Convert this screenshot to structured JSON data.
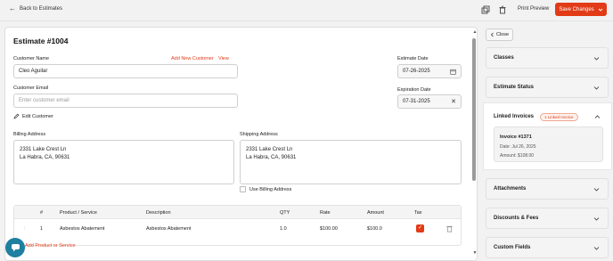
{
  "topbar": {
    "back_label": "Back to Estimates",
    "print_label": "Print Preview",
    "save_label": "Save Changes"
  },
  "form": {
    "title": "Estimate #1004",
    "customer_name_label": "Customer Name",
    "add_new_customer": "Add New Customer",
    "view": "View",
    "customer_name": "Cleo Aguilar",
    "customer_email_label": "Customer Email",
    "customer_email_placeholder": "Enter customer email",
    "edit_customer": "Edit Customer",
    "estimate_date_label": "Estimate Date",
    "estimate_date": "07-26-2025",
    "expiration_date_label": "Expiration Date",
    "expiration_date": "07-31-2025",
    "billing_label": "Billing Address",
    "billing_line1": "2331 Lake Crest Ln",
    "billing_line2": "La Habra, CA, 90631",
    "shipping_label": "Shipping Address",
    "shipping_line1": "2331 Lake Crest Ln",
    "shipping_line2": "La Habra, CA, 90631",
    "use_billing": "Use Billing Address"
  },
  "table": {
    "headers": [
      "#",
      "Product / Service",
      "Description",
      "QTY",
      "Rate",
      "Amount",
      "Tax"
    ],
    "row": {
      "num": "1",
      "product": "Asbestos Abatement",
      "description": "Asbestos Abatement",
      "qty": "1.0",
      "rate": "$100.00",
      "amount": "$100.0",
      "taxed": true
    },
    "add_label": "Add Product or Service"
  },
  "sidebar": {
    "close_label": "Close",
    "sections": {
      "classes": "Classes",
      "estimate_status": "Estimate Status",
      "linked_invoices": "Linked Invoices",
      "attachments": "Attachments",
      "discounts_fees": "Discounts & Fees",
      "custom_fields": "Custom Fields"
    },
    "linked_badge": "1 Linked Invoice",
    "invoice": {
      "number": "Invoice #1371",
      "date": "Date: Jul 26, 2025",
      "amount": "Amount: $108.00"
    }
  },
  "colors": {
    "accent": "#e23b17",
    "chat": "#1e7fa0"
  },
  "icons": [
    "arrow-left-icon",
    "copy-icon",
    "trash-icon",
    "chevron-down-icon",
    "calendar-icon",
    "close-icon",
    "pencil-icon",
    "drag-handle-icon",
    "checkbox-icon",
    "chevron-left-icon",
    "chevron-up-icon",
    "chat-icon"
  ]
}
